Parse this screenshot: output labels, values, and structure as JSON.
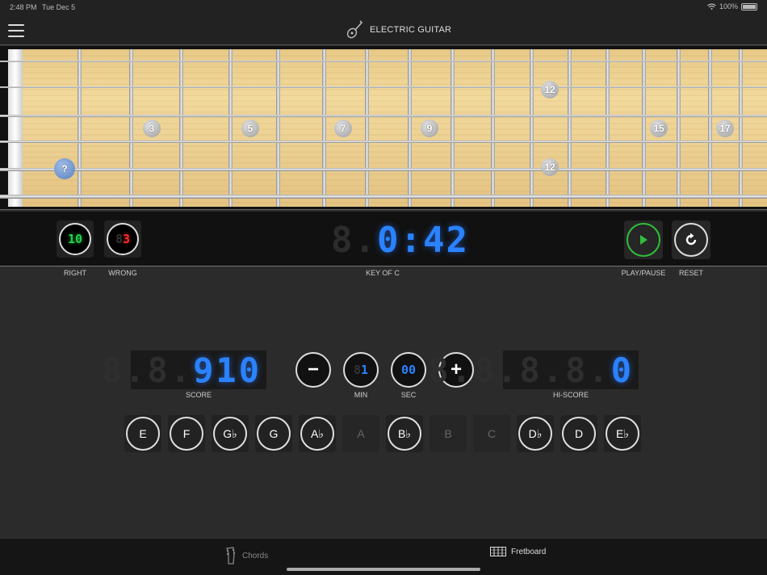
{
  "status_bar": {
    "time": "2:48 PM",
    "date": "Tue Dec 5",
    "battery": "100%"
  },
  "header": {
    "title": "ELECTRIC GUITAR",
    "menu_icon": "hamburger-icon",
    "title_icon": "guitar-icon"
  },
  "fretboard": {
    "fret_markers": [
      "3",
      "5",
      "7",
      "9",
      "12",
      "12",
      "15",
      "17"
    ],
    "question_marker": "?"
  },
  "controls": {
    "right_count": "10",
    "right_ghost": "8",
    "wrong_count": "3",
    "wrong_ghost": "8",
    "timer_ghost": "8.",
    "timer": "0:42",
    "labels": {
      "right": "RIGHT",
      "wrong": "WRONG",
      "key": "KEY OF C",
      "play_pause": "PLAY/PAUSE",
      "reset": "RESET"
    },
    "colors": {
      "right": "#22d04a",
      "wrong": "#ff2a2a",
      "digits": "#2a82ff",
      "play": "#2fbf3a"
    }
  },
  "score": {
    "score_ghost": "8.8.",
    "score_value": "910",
    "score_label": "SCORE",
    "min_value": "1",
    "min_ghost": "8",
    "min_label": "MIN",
    "sec_value": "00",
    "sec_label": "SEC",
    "minus_label": "−",
    "plus_label": "+",
    "hiscore_ghost": "8.8.8.8.",
    "hiscore_value": "0",
    "hiscore_label": "HI-SCORE"
  },
  "notes": [
    {
      "label": "E",
      "enabled": true
    },
    {
      "label": "F",
      "enabled": true
    },
    {
      "label": "G♭",
      "enabled": true
    },
    {
      "label": "G",
      "enabled": true
    },
    {
      "label": "A♭",
      "enabled": true
    },
    {
      "label": "A",
      "enabled": false
    },
    {
      "label": "B♭",
      "enabled": true
    },
    {
      "label": "B",
      "enabled": false
    },
    {
      "label": "C",
      "enabled": false
    },
    {
      "label": "D♭",
      "enabled": true
    },
    {
      "label": "D",
      "enabled": true
    },
    {
      "label": "E♭",
      "enabled": true
    }
  ],
  "tabs": [
    {
      "label": "Chords",
      "icon": "guitar-headstock-icon",
      "active": false
    },
    {
      "label": "Fretboard",
      "icon": "fretboard-icon",
      "active": true
    }
  ]
}
